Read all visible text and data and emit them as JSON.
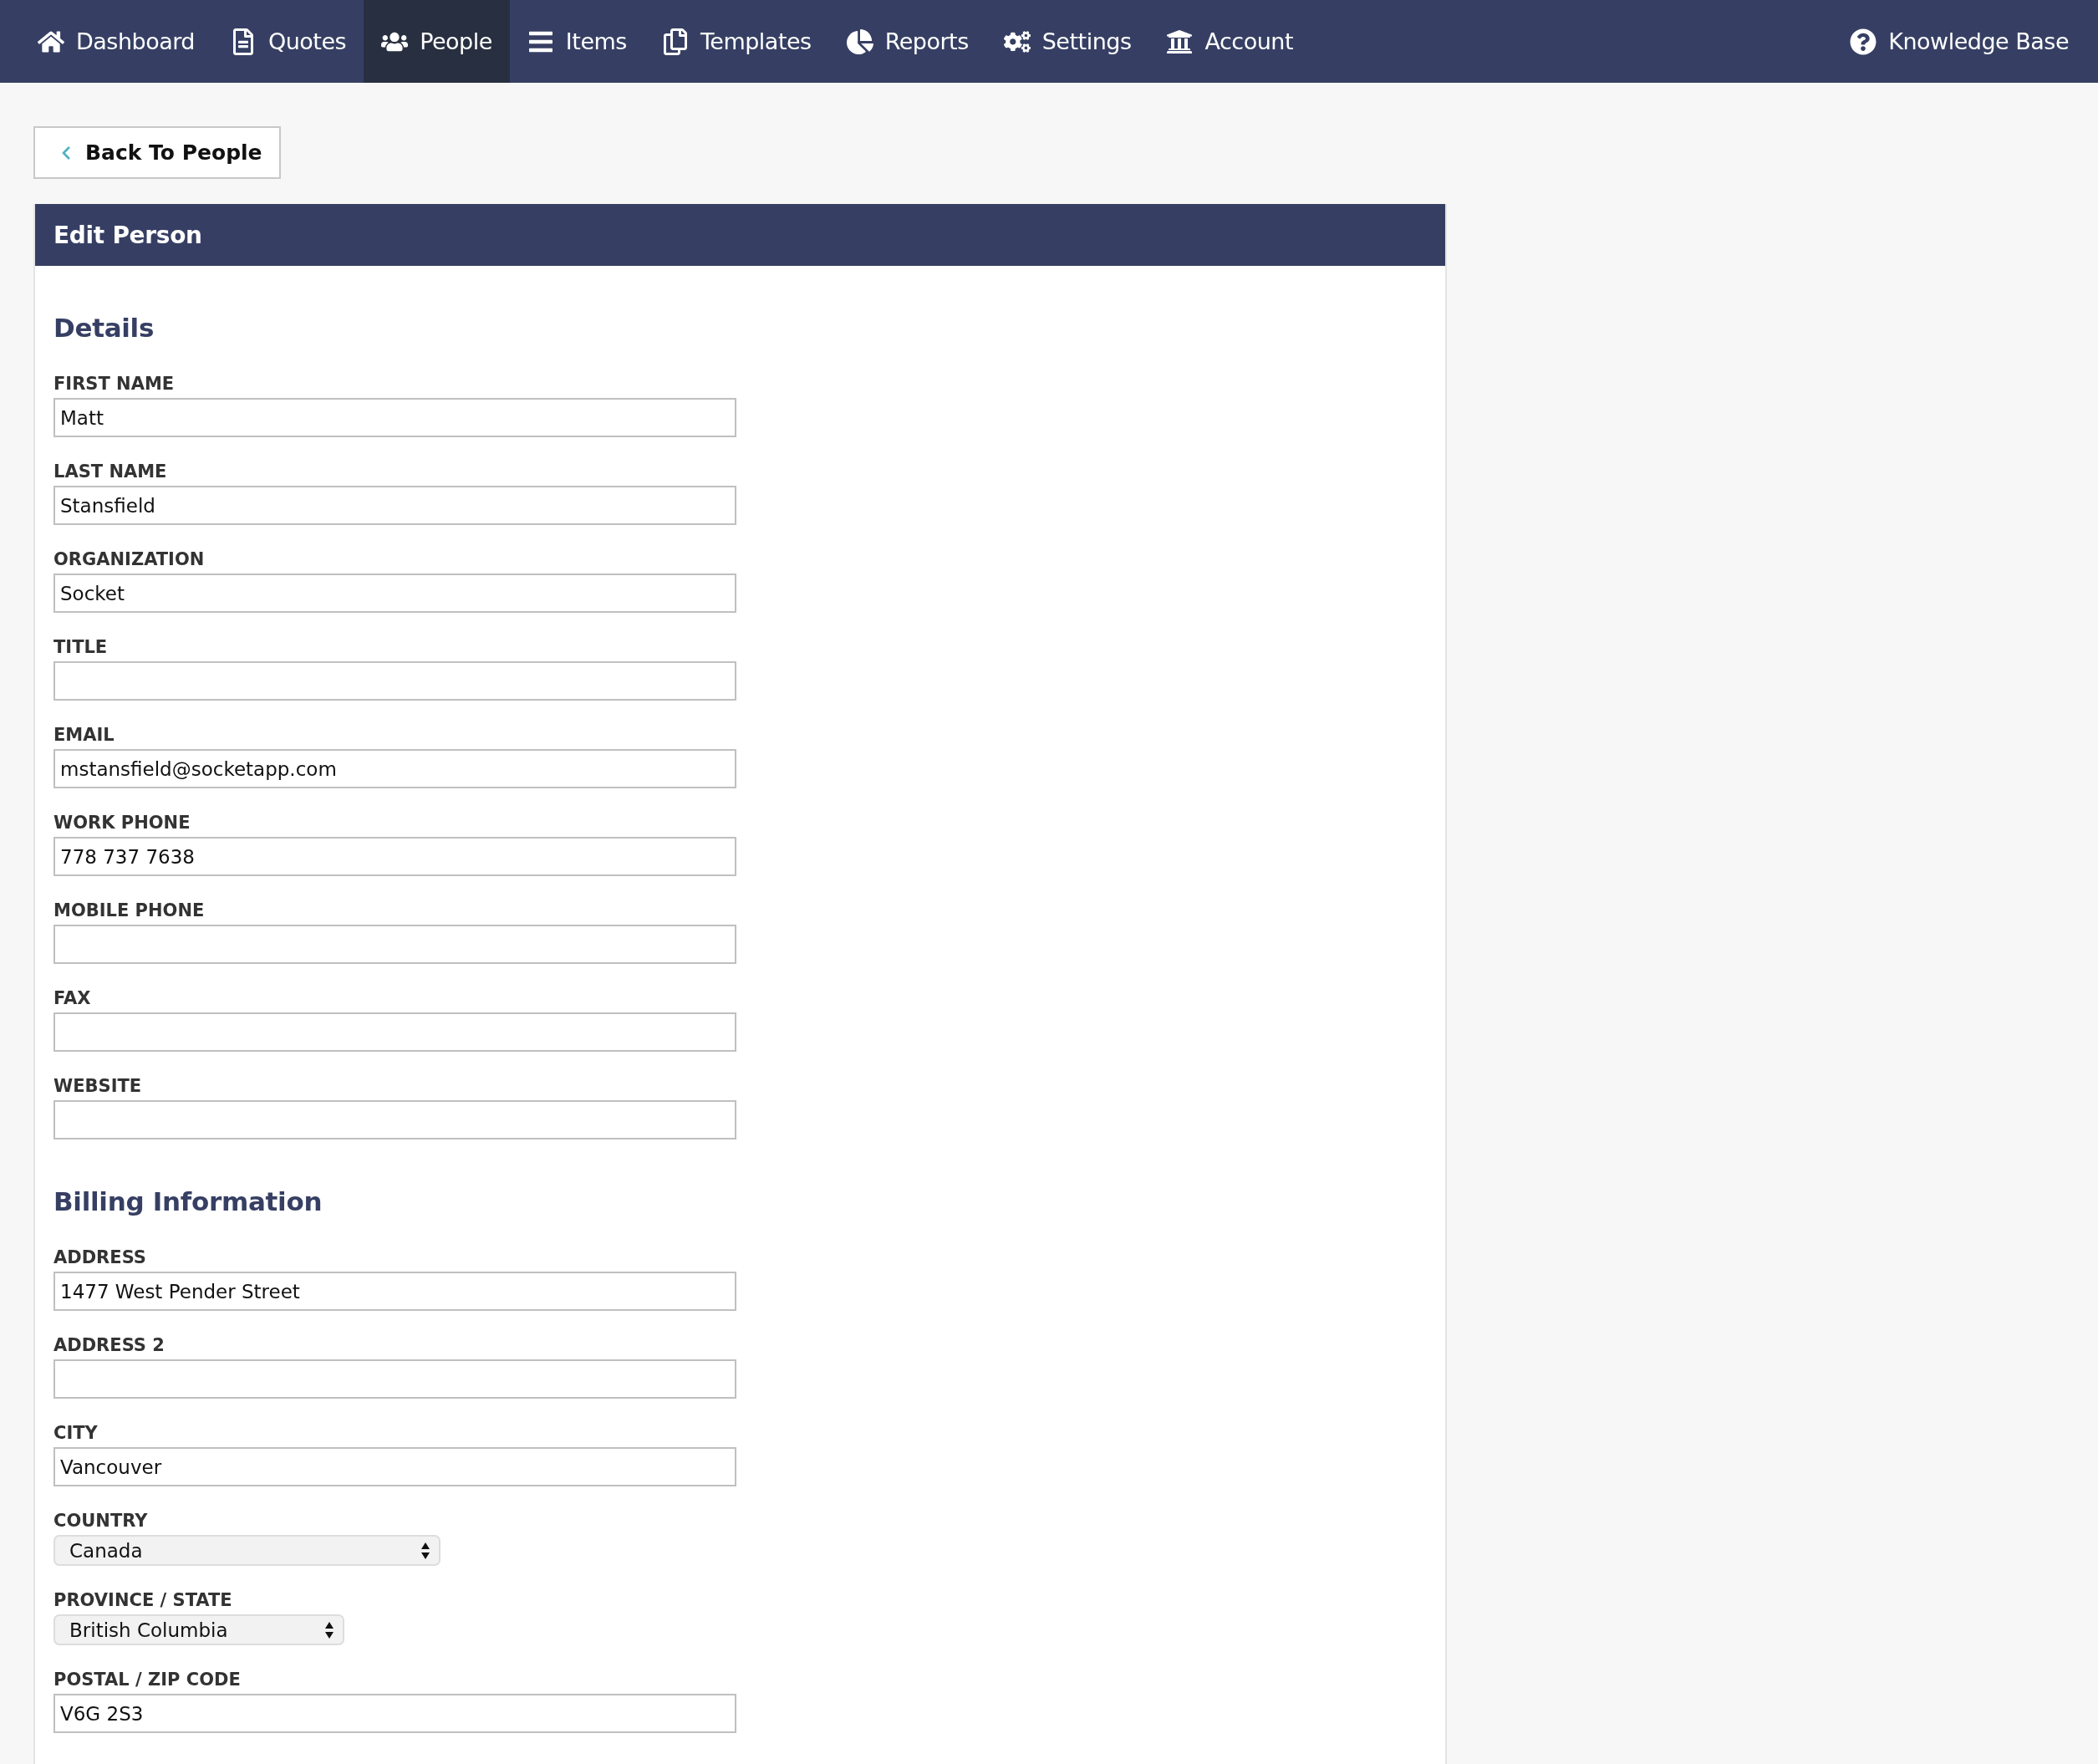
{
  "nav": {
    "items": [
      {
        "label": "Dashboard",
        "selected": false
      },
      {
        "label": "Quotes",
        "selected": false
      },
      {
        "label": "People",
        "selected": true
      },
      {
        "label": "Items",
        "selected": false
      },
      {
        "label": "Templates",
        "selected": false
      },
      {
        "label": "Reports",
        "selected": false
      },
      {
        "label": "Settings",
        "selected": false
      },
      {
        "label": "Account",
        "selected": false
      }
    ],
    "help_link": "Knowledge Base"
  },
  "back_button": "Back To People",
  "panel": {
    "title": "Edit Person",
    "sections": [
      {
        "heading": "Details",
        "fields": [
          {
            "kind": "text",
            "label": "FIRST NAME",
            "value": "Matt"
          },
          {
            "kind": "text",
            "label": "LAST NAME",
            "value": "Stansfield"
          },
          {
            "kind": "text",
            "label": "ORGANIZATION",
            "value": "Socket"
          },
          {
            "kind": "text",
            "label": "TITLE"
          },
          {
            "kind": "text",
            "label": "EMAIL",
            "value": "mstansfield@socketapp.com"
          },
          {
            "kind": "text",
            "label": "WORK PHONE",
            "value": "778 737 7638"
          },
          {
            "kind": "text",
            "label": "MOBILE PHONE"
          },
          {
            "kind": "text",
            "label": "FAX"
          },
          {
            "kind": "text",
            "label": "WEBSITE"
          }
        ]
      },
      {
        "heading": "Billing Information",
        "fields": [
          {
            "kind": "text",
            "label": "ADDRESS",
            "value": "1477 West Pender Street"
          },
          {
            "kind": "text",
            "label": "ADDRESS 2"
          },
          {
            "kind": "text",
            "label": "CITY",
            "value": "Vancouver"
          },
          {
            "kind": "select",
            "label": "COUNTRY",
            "value": "Canada"
          },
          {
            "kind": "select",
            "label": "PROVINCE / STATE",
            "value": "British Columbia"
          },
          {
            "kind": "text",
            "label": "POSTAL / ZIP CODE",
            "value": "V6G 2S3"
          }
        ]
      }
    ]
  }
}
